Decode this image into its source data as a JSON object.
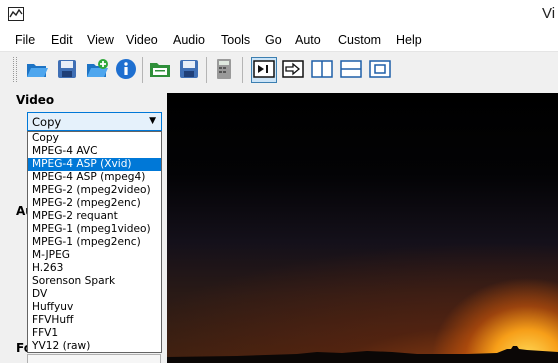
{
  "window": {
    "title": "Vi"
  },
  "menu": [
    "File",
    "Edit",
    "View",
    "Video",
    "Audio",
    "Tools",
    "Go",
    "Auto",
    "Custom",
    "Help"
  ],
  "toolbar": {
    "buttons": [
      {
        "icon": "open-folder-icon"
      },
      {
        "icon": "save-icon"
      },
      {
        "icon": "append-icon"
      },
      {
        "icon": "info-icon"
      },
      {
        "icon": "save-folder-icon"
      },
      {
        "icon": "save-video-icon"
      },
      {
        "icon": "calculator-icon"
      },
      {
        "icon": "input-view-icon"
      },
      {
        "icon": "output-view-icon"
      },
      {
        "icon": "side-by-side-icon"
      },
      {
        "icon": "top-bottom-icon"
      },
      {
        "icon": "display-icon"
      }
    ]
  },
  "video": {
    "section_label": "Video",
    "codec_selected": "Copy",
    "codec_options": [
      "Copy",
      "MPEG-4 AVC",
      "MPEG-4 ASP (Xvid)",
      "MPEG-4 ASP (mpeg4)",
      "MPEG-2 (mpeg2video)",
      "MPEG-2 (mpeg2enc)",
      "MPEG-2 requant",
      "MPEG-1 (mpeg1video)",
      "MPEG-1 (mpeg2enc)",
      "M-JPEG",
      "H.263",
      "Sorenson Spark",
      "DV",
      "Huffyuv",
      "FFVHuff",
      "FFV1",
      "YV12 (raw)"
    ],
    "highlighted_option": "MPEG-4 ASP (Xvid)"
  },
  "audio": {
    "section_label_partial": "Au"
  },
  "format": {
    "section_label_partial": "Fo"
  },
  "colors": {
    "accent": "#0078d7",
    "combo_bg": "#e5f1fb"
  }
}
